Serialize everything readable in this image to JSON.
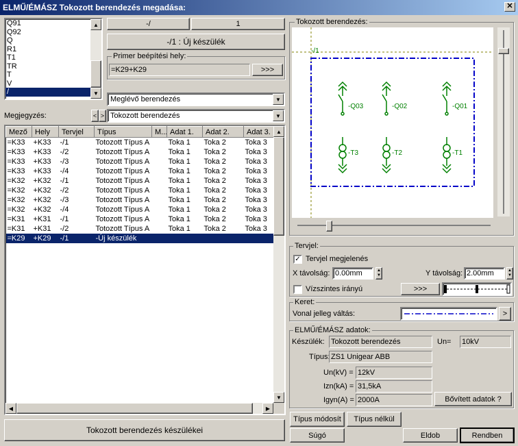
{
  "window": {
    "title": "ELMŰ/ÉMÁSZ Tokozott berendezés megadása:"
  },
  "list": {
    "items": [
      "Q91",
      "Q92",
      "Q",
      "R1",
      "T1",
      "TR",
      "T",
      "V",
      "/"
    ],
    "selected": 8
  },
  "top_buttons": {
    "b1": "-/",
    "b2": "1",
    "new_device": "-/1  :  Új készülék"
  },
  "primer": {
    "label": "Primer beépítési hely:",
    "value": "=K29+K29",
    "btn": ">>>"
  },
  "meglevo": {
    "value": "Meglévő berendezés"
  },
  "megjegyzes": {
    "label": "Megjegyzés:",
    "value": "Tokozott berendezés"
  },
  "table": {
    "headers": [
      "Mező",
      "Hely",
      "Tervjel",
      "Típus",
      "M...",
      "Adat 1.",
      "Adat 2.",
      "Adat 3."
    ],
    "rows": [
      [
        "=K33",
        "+K33",
        "-/1",
        "Totozott Típus A",
        "",
        "Toka 1",
        "Toka 2",
        "Toka 3"
      ],
      [
        "=K33",
        "+K33",
        "-/2",
        "Totozott Típus A",
        "",
        "Toka 1",
        "Toka 2",
        "Toka 3"
      ],
      [
        "=K33",
        "+K33",
        "-/3",
        "Totozott Típus A",
        "",
        "Toka 1",
        "Toka 2",
        "Toka 3"
      ],
      [
        "=K33",
        "+K33",
        "-/4",
        "Totozott Típus A",
        "",
        "Toka 1",
        "Toka 2",
        "Toka 3"
      ],
      [
        "=K32",
        "+K32",
        "-/1",
        "Totozott Típus A",
        "",
        "Toka 1",
        "Toka 2",
        "Toka 3"
      ],
      [
        "=K32",
        "+K32",
        "-/2",
        "Totozott Típus A",
        "",
        "Toka 1",
        "Toka 2",
        "Toka 3"
      ],
      [
        "=K32",
        "+K32",
        "-/3",
        "Totozott Típus A",
        "",
        "Toka 1",
        "Toka 2",
        "Toka 3"
      ],
      [
        "=K32",
        "+K32",
        "-/4",
        "Totozott Típus A",
        "",
        "Toka 1",
        "Toka 2",
        "Toka 3"
      ],
      [
        "=K31",
        "+K31",
        "-/1",
        "Totozott Típus A",
        "",
        "Toka 1",
        "Toka 2",
        "Toka 3"
      ],
      [
        "=K31",
        "+K31",
        "-/2",
        "Totozott Típus A",
        "",
        "Toka 1",
        "Toka 2",
        "Toka 3"
      ],
      [
        "=K29",
        "+K29",
        "-/1",
        "-Új készülék",
        "",
        "",
        "",
        ""
      ]
    ],
    "selected": 10
  },
  "bottom_left_button": "Tokozott berendezés készülékei",
  "preview": {
    "label": "Tokozott berendezés:",
    "ref": "-/1",
    "q": [
      "-Q03",
      "-Q02",
      "-Q01"
    ],
    "t": [
      "-T3",
      "-T2",
      "-T1"
    ]
  },
  "tervjel": {
    "label": "Tervjel:",
    "show_label": "Tervjel megjelenés",
    "show_checked": true,
    "x_label": "X távolság:",
    "x_value": "0.00mm",
    "y_label": "Y távolság:",
    "y_value": "2.00mm",
    "horiz_label": "Vízszintes irányú",
    "horiz_checked": false,
    "btn": ">>>"
  },
  "keret": {
    "label": "Keret:",
    "line_label": "Vonal jelleg váltás:",
    "btn": ">"
  },
  "adatok": {
    "label": "ELMŰ/ÉMÁSZ adatok:",
    "keszulek_label": "Készülék:",
    "keszulek": "Tokozott berendezés",
    "un_label": "Un=",
    "un": "10kV",
    "tipus_label": "Típus:",
    "tipus": "ZS1 Unigear ABB",
    "un_kv_label": "Un(kV) =",
    "un_kv": "12kV",
    "izn_label": "Izn(kA) =",
    "izn": "31,5kA",
    "igyn_label": "Igyn(A) =",
    "igyn": "2000A",
    "more_btn": "Bővített adatok ?"
  },
  "bottom_buttons": {
    "tipus_modosit": "Típus módosít",
    "tipus_nelkul": "Típus nélkül",
    "sugo": "Súgó",
    "eldob": "Eldob",
    "rendben": "Rendben"
  },
  "colors": {
    "title_start": "#0a246a",
    "title_end": "#a6caf0",
    "symbol": "#008000",
    "frame": "#0000c8"
  }
}
